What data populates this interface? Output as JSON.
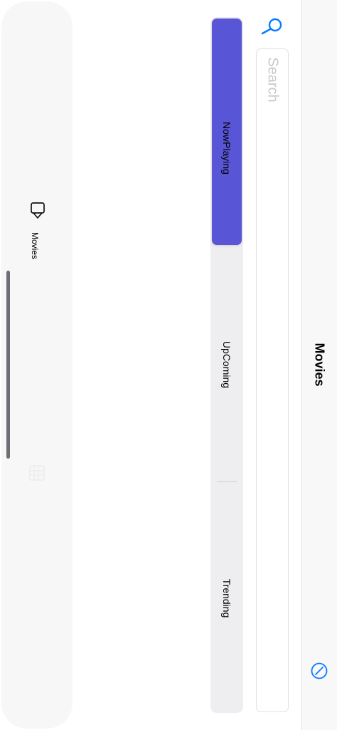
{
  "nav": {
    "title": "Movies",
    "right_icon": "compass-icon"
  },
  "search": {
    "placeholder": "Search",
    "icon": "magnifier-icon"
  },
  "segments": {
    "selected_index": 0,
    "accent_color": "#5856D6",
    "items": [
      {
        "label": "NowPlaying"
      },
      {
        "label": "UpComing"
      },
      {
        "label": "Trending"
      }
    ]
  },
  "tabbar": {
    "items": [
      {
        "label": "Movies",
        "icon": "video-camera-icon"
      },
      {
        "label": "",
        "icon": "calendar-icon"
      }
    ]
  }
}
